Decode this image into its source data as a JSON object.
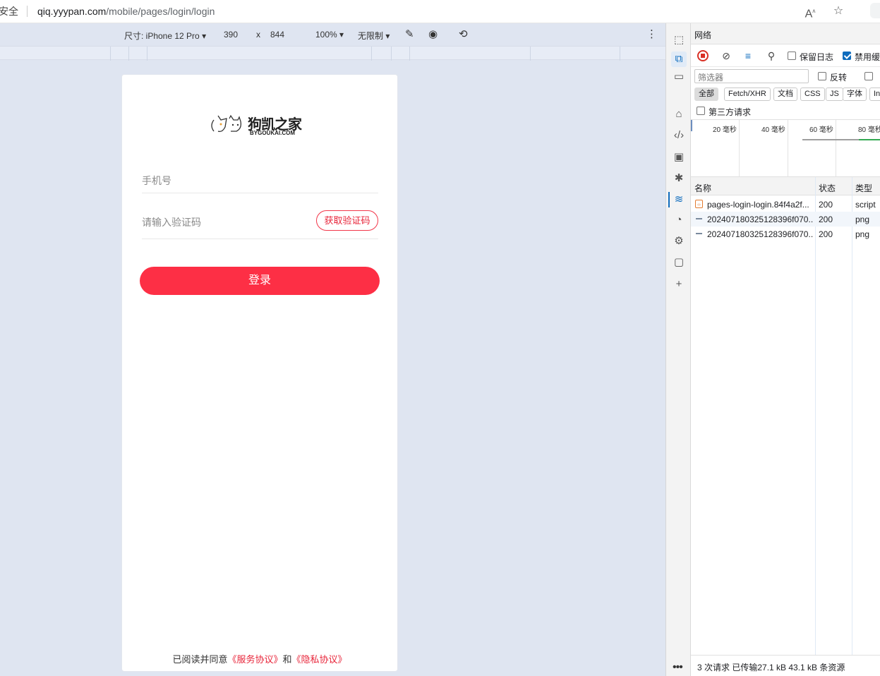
{
  "browser": {
    "security_text": "安全",
    "url_host": "qiq.yyypan.com",
    "url_path": "/mobile/pages/login/login",
    "read_aloud_icon": "read-aloud-icon",
    "favorite_icon": "star-icon"
  },
  "device_toolbar": {
    "dimensions_label": "尺寸: iPhone 12 Pro",
    "width": "390",
    "times": "x",
    "height": "844",
    "zoom": "100%",
    "throttle": "无限制"
  },
  "app": {
    "logo_title": "狗凯之家",
    "logo_subtitle": "BYGOUKAI.COM",
    "phone_placeholder": "手机号",
    "code_placeholder": "请输入验证码",
    "get_code_button": "获取验证码",
    "login_button": "登录",
    "agreement_prefix": "已阅读并同意",
    "service_agreement": "《服务协议》",
    "agreement_and": "和",
    "privacy_agreement": "《隐私协议》",
    "accent_color": "#fd2f45"
  },
  "devtools": {
    "panel_title": "网络",
    "preserve_log": "保留日志",
    "disable_cache": "禁用缓",
    "filter_placeholder": "筛选器",
    "invert": "反转",
    "filter_chips": [
      "全部",
      "Fetch/XHR",
      "文档",
      "CSS",
      "JS",
      "字体",
      "In"
    ],
    "third_party": "第三方请求",
    "timeline_ticks": [
      "20 毫秒",
      "40 毫秒",
      "60 毫秒",
      "80 毫秒"
    ],
    "columns": [
      "名称",
      "状态",
      "类型"
    ],
    "requests": [
      {
        "name": "pages-login-login.84f4a2f...",
        "status": "200",
        "type": "script"
      },
      {
        "name": "20240718032512839​6f070...",
        "status": "200",
        "type": "png"
      },
      {
        "name": "20240718032512839​6f070...",
        "status": "200",
        "type": "png"
      }
    ],
    "summary": "3 次请求  已传输27.1 kB  43.1 kB 条资源"
  }
}
